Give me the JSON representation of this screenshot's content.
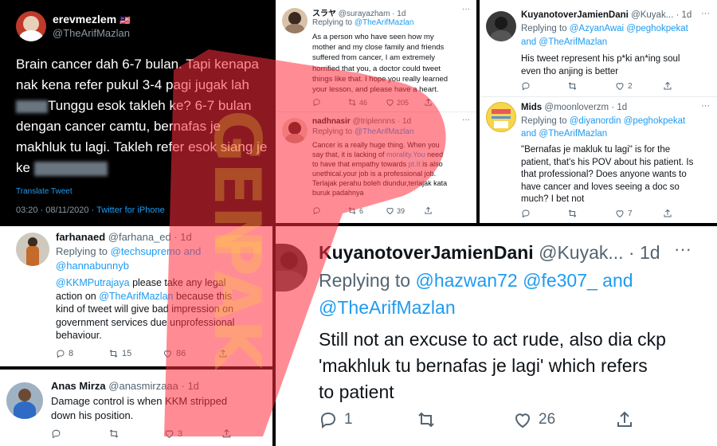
{
  "main_tweet": {
    "name": "erevmezlem",
    "flag": "🇲🇾",
    "handle": "@TheArifMazlan",
    "lines": [
      "Brain cancer dah 6-7 bulan. Tapi kenapa",
      "nak kena refer pukul 3-4 pagi jugak lah",
      "Tunggu esok takleh ke? 6-7 bulan",
      "dengan cancer camtu, bernafas je",
      "makhluk tu lagi. Takleh refer esok siang je",
      "ke"
    ],
    "translate": "Translate Tweet",
    "time": "03:20 · 08/11/2020 · ",
    "source": "Twitter for iPhone"
  },
  "tweet_suraya": {
    "name": "スラヤ",
    "handle": "@surayazham · 1d",
    "replying_prefix": "Replying to ",
    "replying_to": "@TheArifMazlan",
    "lines": [
      "As a person who have seen how my",
      "mother and my close family and friends",
      "suffered from cancer, I am extremely",
      "horrified that you, a doctor could tweet",
      "things like that. I hope you really learned",
      "your lesson, and please have a heart."
    ],
    "retweets": "46",
    "likes": "205"
  },
  "tweet_nadh": {
    "name": "nadhnasir",
    "handle": "@triplennns · 1d",
    "replying_prefix": "Replying to ",
    "replying_to": "@TheArifMazlan",
    "line1": "Cancer is a really huge thing. When you",
    "line2_a": "say that, it is lacking of ",
    "line2_b": "morality.You",
    "line2_c": " need",
    "line3_a": "to have that empathy towards ",
    "line3_b": "pt.It",
    "line3_c": " is also",
    "line4": "unethical.your job is a professional job.",
    "line5": "Terlajak perahu boleh diundur,terlajak kata",
    "line6": "buruk padahnya",
    "retweets": "6",
    "likes": "39"
  },
  "tweet_kuyan_small": {
    "name": "KuyanotoverJamienDani",
    "handle": "@Kuyak... · 1d",
    "replying_prefix": "Replying to ",
    "replying_a": "@AzyanAwai",
    "replying_b": "@peghokpekat",
    "replying_and": "and ",
    "replying_c": "@TheArifMazlan",
    "line1": "His tweet represent his p*ki an*ing soul",
    "line2": "even tho anjing is better",
    "likes": "2"
  },
  "tweet_mids": {
    "name": "Mids",
    "handle": "@moonloverzm · 1d",
    "replying_prefix": "Replying to ",
    "replying_a": "@diyanordin",
    "replying_b": "@peghokpekat",
    "replying_and": "and ",
    "replying_c": "@TheArifMazlan",
    "lines": [
      "\"Bernafas je makluk tu lagi\" is for the",
      "patient, that's his POV about his patient. Is",
      "that professional? Does anyone wants to",
      "have cancer and loves seeing a doc so",
      "much? I bet not"
    ],
    "likes": "7"
  },
  "tweet_farhana": {
    "name": "farhanaed",
    "handle": "@farhana_ed · 1d",
    "replying_prefix": "Replying to ",
    "replying_a": "@techsupremo",
    "replying_and": " and",
    "replying_b": "@hannabunnyb",
    "mention": "@KKMPutrajaya",
    "line1_rest": " please take any legal",
    "line2_a": "action on ",
    "line2_b": "@TheArifMazlan",
    "line2_c": " because this",
    "line3": "kind of tweet will give bad impression on",
    "line4": "government services due unprofessional",
    "line5": "behaviour.",
    "replies": "8",
    "retweets": "15",
    "likes": "86"
  },
  "tweet_anas": {
    "name": "Anas Mirza",
    "handle": "@anasmirzaaa · 1d",
    "line1": "Damage control is when KKM stripped",
    "line2": "down his position.",
    "likes": "3"
  },
  "tweet_kuyan_big": {
    "name": "KuyanotoverJamienDani",
    "handle": "@Kuyak... · 1d",
    "more": "···",
    "replying_prefix": "Replying to ",
    "replying_a": "@hazwan72",
    "replying_b": "@fe307_",
    "replying_and": " and",
    "replying_c": "@TheArifMazlan",
    "lines": [
      "Still not an excuse to act rude, also dia ckp",
      "'makhluk tu bernafas je lagi' which refers",
      "to patient"
    ],
    "replies": "1",
    "likes": "26"
  },
  "watermark": {
    "line1": "GEN",
    "line2": "PAK"
  },
  "colors": {
    "link": "#1d9bf0",
    "watermark": "#ff2d3d",
    "watermark_text": "#ffd23a"
  }
}
